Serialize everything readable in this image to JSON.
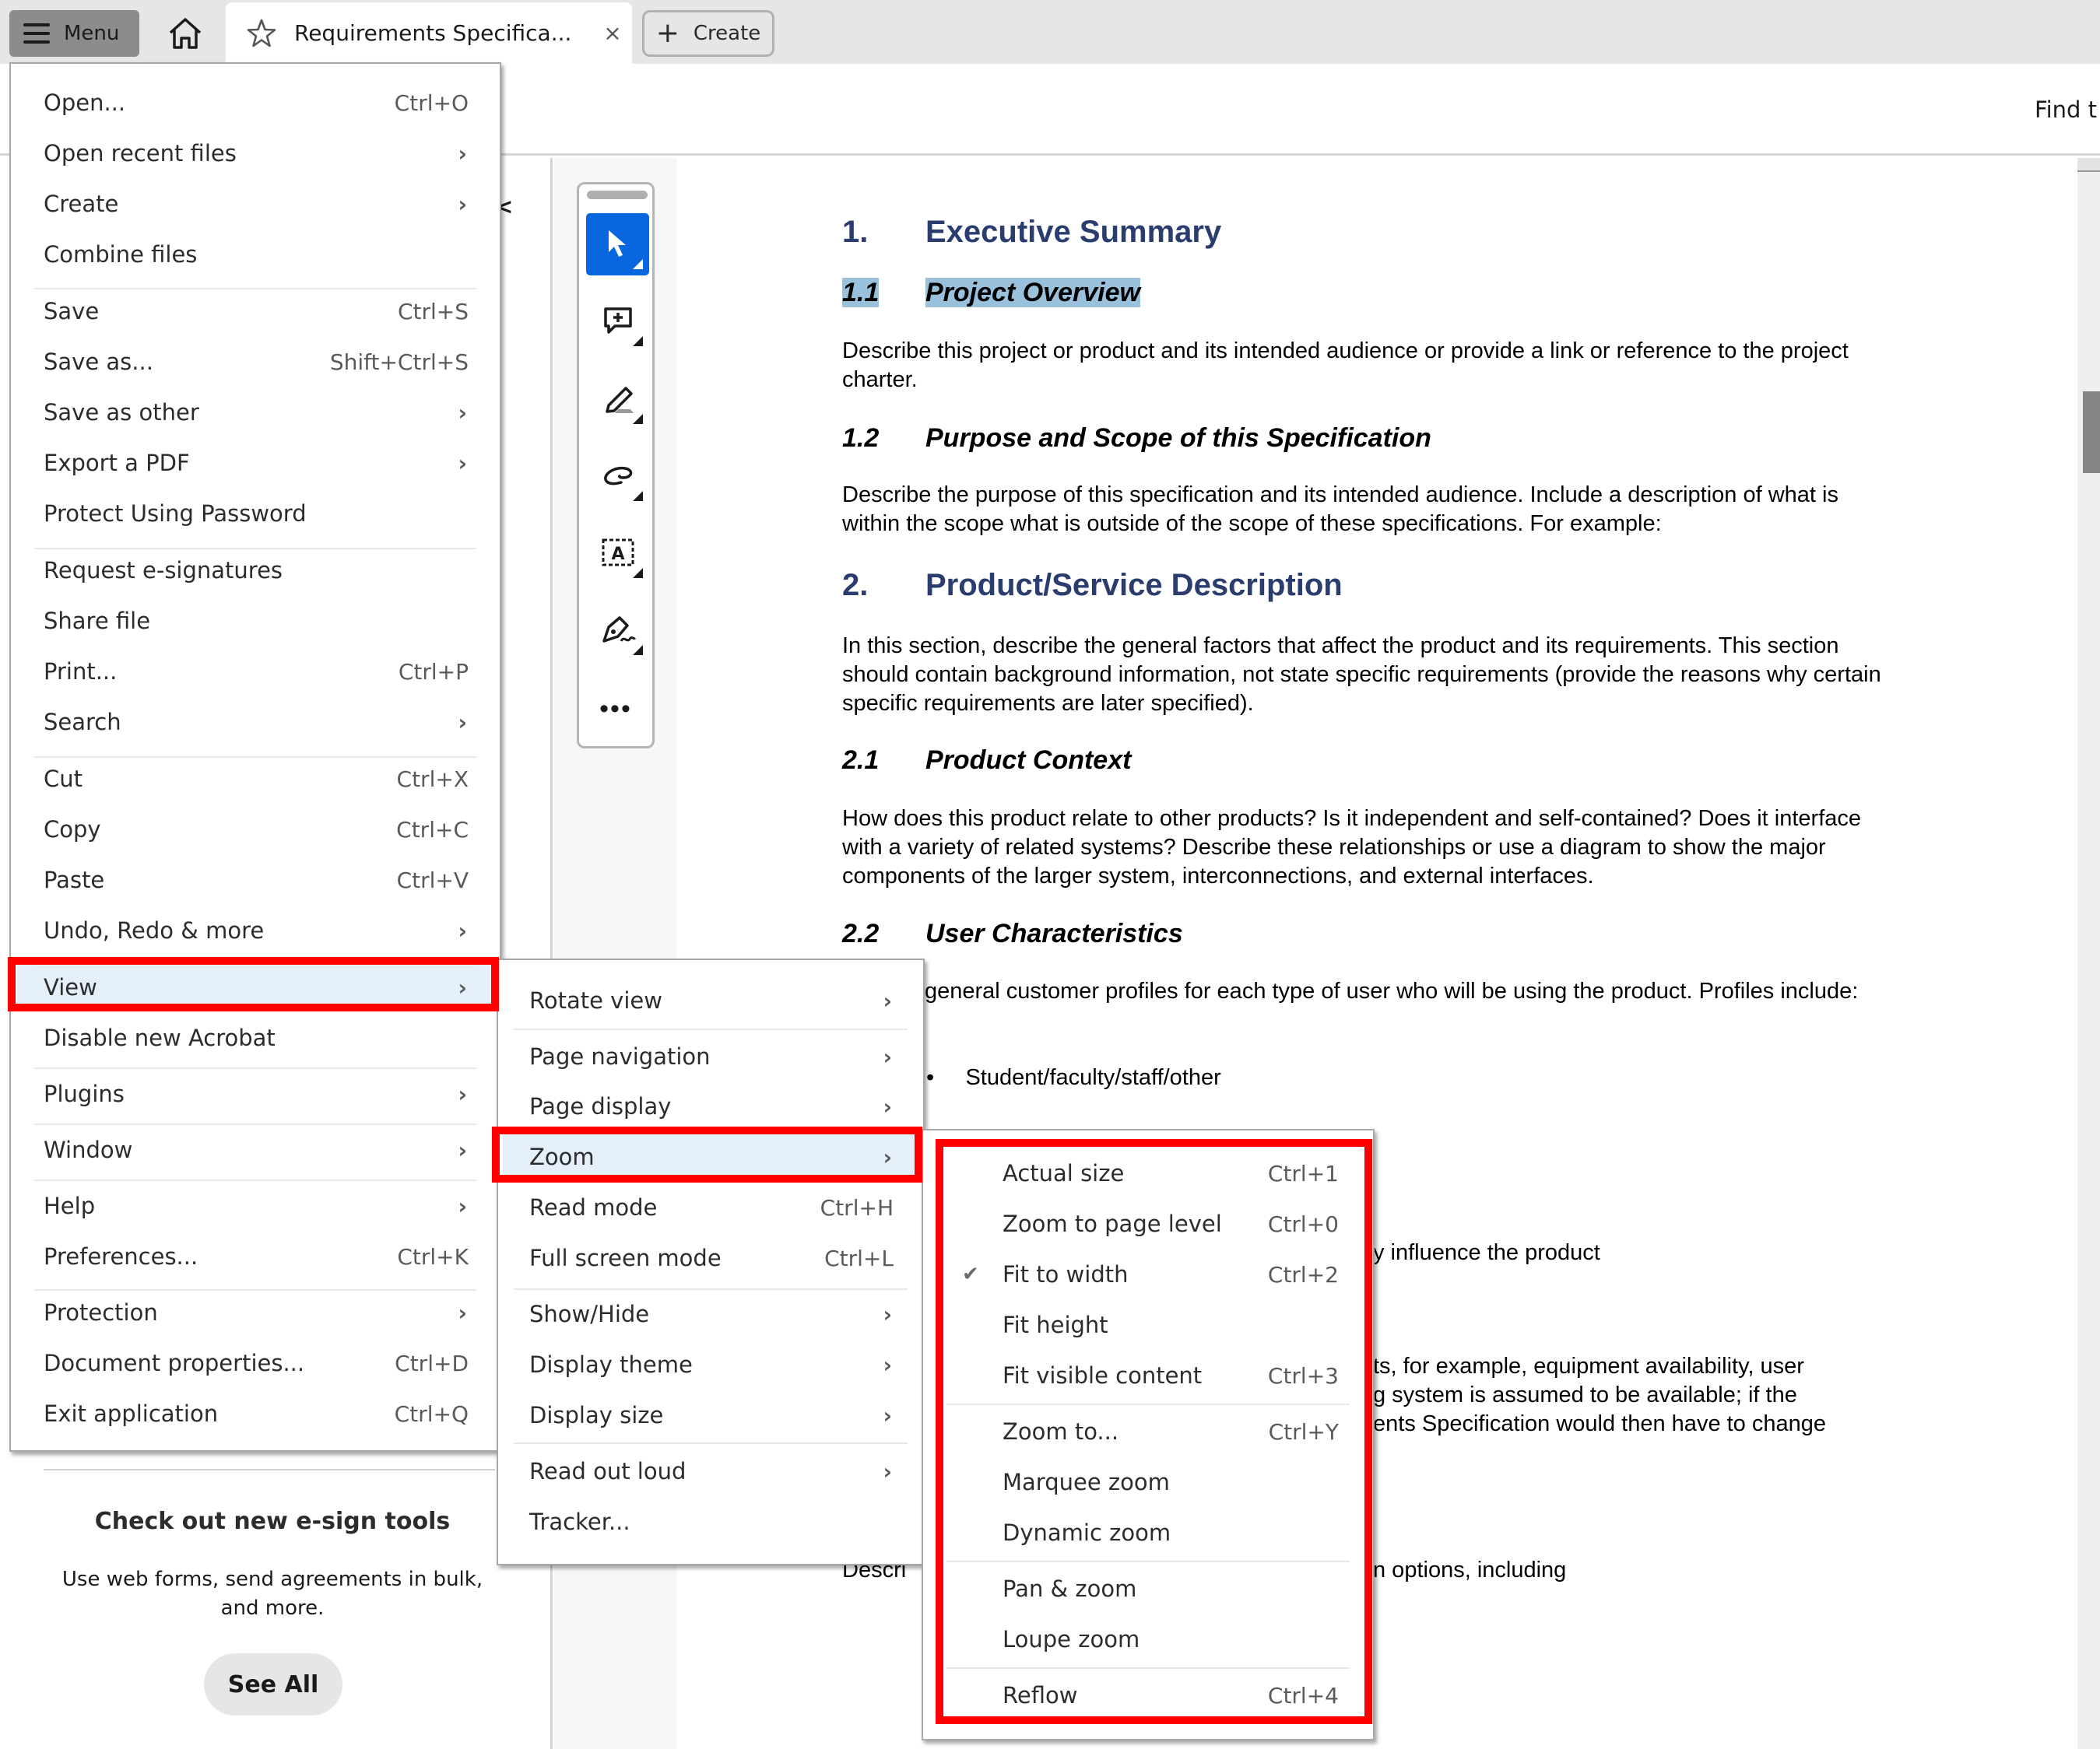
{
  "topbar": {
    "menu_label": "Menu",
    "tab_title": "Requirements Specifica...",
    "tab_close": "×",
    "create_label": "Create"
  },
  "secbar": {
    "find_text": "Find t"
  },
  "left_panel": {
    "esign_title": "Check out new e-sign tools",
    "esign_desc": "Use web forms, send agreements in bulk, and more.",
    "see_all": "See All"
  },
  "toolbar": {
    "tools": [
      "select-tool",
      "add-comment-tool",
      "highlight-tool",
      "draw-freeform-tool",
      "add-text-tool",
      "sign-tool"
    ],
    "more": "•••"
  },
  "main_menu": {
    "items": [
      {
        "label": "Open...",
        "shortcut": "Ctrl+O",
        "submenu": false
      },
      {
        "label": "Open recent files",
        "shortcut": "",
        "submenu": true
      },
      {
        "label": "Create",
        "shortcut": "",
        "submenu": true
      },
      {
        "label": "Combine files",
        "shortcut": "",
        "submenu": false
      },
      {
        "label": "Save",
        "shortcut": "Ctrl+S",
        "submenu": false
      },
      {
        "label": "Save as...",
        "shortcut": "Shift+Ctrl+S",
        "submenu": false
      },
      {
        "label": "Save as other",
        "shortcut": "",
        "submenu": true
      },
      {
        "label": "Export a PDF",
        "shortcut": "",
        "submenu": true
      },
      {
        "label": "Protect Using Password",
        "shortcut": "",
        "submenu": false
      },
      {
        "label": "Request e-signatures",
        "shortcut": "",
        "submenu": false
      },
      {
        "label": "Share file",
        "shortcut": "",
        "submenu": false
      },
      {
        "label": "Print...",
        "shortcut": "Ctrl+P",
        "submenu": false
      },
      {
        "label": "Search",
        "shortcut": "",
        "submenu": true
      },
      {
        "label": "Cut",
        "shortcut": "Ctrl+X",
        "submenu": false
      },
      {
        "label": "Copy",
        "shortcut": "Ctrl+C",
        "submenu": false
      },
      {
        "label": "Paste",
        "shortcut": "Ctrl+V",
        "submenu": false
      },
      {
        "label": "Undo, Redo & more",
        "shortcut": "",
        "submenu": true
      },
      {
        "label": "View",
        "shortcut": "",
        "submenu": true,
        "highlighted": true
      },
      {
        "label": "Disable new Acrobat",
        "shortcut": "",
        "submenu": false
      },
      {
        "label": "Plugins",
        "shortcut": "",
        "submenu": true
      },
      {
        "label": "Window",
        "shortcut": "",
        "submenu": true
      },
      {
        "label": "Help",
        "shortcut": "",
        "submenu": true
      },
      {
        "label": "Preferences...",
        "shortcut": "Ctrl+K",
        "submenu": false
      },
      {
        "label": "Protection",
        "shortcut": "",
        "submenu": true
      },
      {
        "label": "Document properties...",
        "shortcut": "Ctrl+D",
        "submenu": false
      },
      {
        "label": "Exit application",
        "shortcut": "Ctrl+Q",
        "submenu": false
      }
    ]
  },
  "view_menu": {
    "items": [
      {
        "label": "Rotate view",
        "shortcut": "",
        "submenu": true
      },
      {
        "label": "Page navigation",
        "shortcut": "",
        "submenu": true
      },
      {
        "label": "Page display",
        "shortcut": "",
        "submenu": true
      },
      {
        "label": "Zoom",
        "shortcut": "",
        "submenu": true,
        "highlighted": true
      },
      {
        "label": "Read mode",
        "shortcut": "Ctrl+H",
        "submenu": false
      },
      {
        "label": "Full screen mode",
        "shortcut": "Ctrl+L",
        "submenu": false
      },
      {
        "label": "Show/Hide",
        "shortcut": "",
        "submenu": true
      },
      {
        "label": "Display theme",
        "shortcut": "",
        "submenu": true
      },
      {
        "label": "Display size",
        "shortcut": "",
        "submenu": true
      },
      {
        "label": "Read out loud",
        "shortcut": "",
        "submenu": true
      },
      {
        "label": "Tracker...",
        "shortcut": "",
        "submenu": false
      }
    ]
  },
  "zoom_menu": {
    "items": [
      {
        "label": "Actual size",
        "shortcut": "Ctrl+1",
        "checked": false
      },
      {
        "label": "Zoom to page level",
        "shortcut": "Ctrl+0",
        "checked": false
      },
      {
        "label": "Fit to width",
        "shortcut": "Ctrl+2",
        "checked": true
      },
      {
        "label": "Fit height",
        "shortcut": "",
        "checked": false
      },
      {
        "label": "Fit visible content",
        "shortcut": "Ctrl+3",
        "checked": false
      },
      {
        "label": "Zoom to...",
        "shortcut": "Ctrl+Y",
        "checked": false
      },
      {
        "label": "Marquee zoom",
        "shortcut": "",
        "checked": false
      },
      {
        "label": "Dynamic zoom",
        "shortcut": "",
        "checked": false
      },
      {
        "label": "Pan & zoom",
        "shortcut": "",
        "checked": false
      },
      {
        "label": "Loupe zoom",
        "shortcut": "",
        "checked": false
      },
      {
        "label": "Reflow",
        "shortcut": "Ctrl+4",
        "checked": false
      }
    ]
  },
  "document": {
    "h1_1_num": "1.",
    "h1_1": "Executive Summary",
    "h2_11_num": "1.1",
    "h2_11": "Project Overview",
    "p_11": "Describe this project or product and its intended audience or provide a link or reference to the project charter.",
    "h2_12_num": "1.2",
    "h2_12": "Purpose and Scope of this Specification",
    "p_12": "Describe the purpose of this specification and its intended audience.   Include a description of what is within the scope what is outside of the scope of these specifications.  For example:",
    "h1_2_num": "2.",
    "h1_2": "Product/Service Description",
    "p_2": "In this section, describe the general factors that affect the product and its requirements. This section should contain background information, not state specific requirements (provide the reasons why certain specific requirements are later specified).",
    "h2_21_num": "2.1",
    "h2_21": "Product Context",
    "p_21": "How does this product relate to other products? Is it independent and self-contained?  Does it interface with a variety of related systems?  Describe these relationships or use a diagram to show the major components of the larger system, interconnections, and external interfaces.",
    "h2_22_num": "2.2",
    "h2_22": "User Characteristics",
    "p_22_visible": "general customer profiles for each type of user who will be using the product. Profiles include:",
    "bullet_1": "Student/faculty/staff/other",
    "frag_influence": "y influence the product",
    "frag_line1": "ts, for example, equipment availability, user",
    "frag_line2": "g system is assumed to be available; if  the",
    "frag_line3": "ents Specification would then have to change",
    "frag_descri": "Descri",
    "frag_options": "n options, including"
  },
  "colors": {
    "highlight_red": "#ff0000",
    "menu_highlight": "#e5eff9",
    "active_tool": "#0866df",
    "heading_blue": "#2a3d6e",
    "selection": "#99c1dc"
  }
}
